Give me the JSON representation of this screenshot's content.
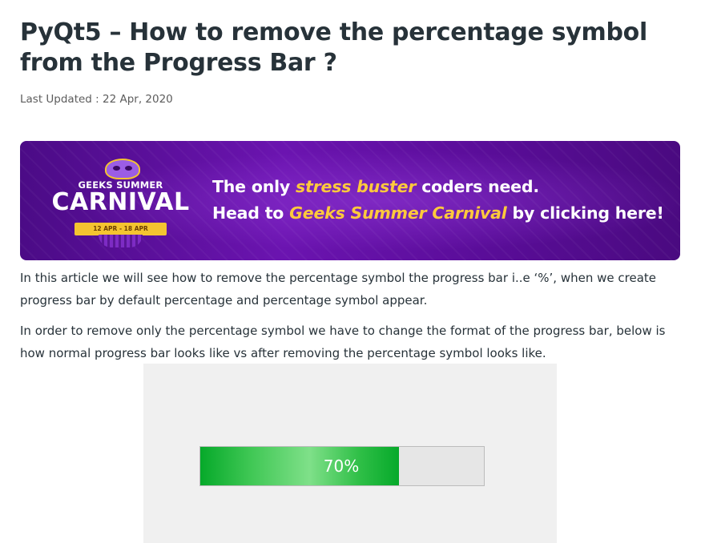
{
  "article": {
    "title": "PyQt5 – How to remove the percentage symbol from the Progress Bar ?",
    "last_updated": "Last Updated : 22 Apr, 2020"
  },
  "banner": {
    "logo_top": "GEEKS SUMMER",
    "logo_main": "CARNIVAL",
    "logo_dates": "12 APR - 18 APR",
    "line1_a": "The only ",
    "line1_highlight": "stress buster",
    "line1_b": " coders need.",
    "line2_a": "Head to ",
    "line2_highlight": "Geeks Summer Carnival",
    "line2_b": " by clicking here!",
    "colors": {
      "background": "#5a0d99",
      "highlight": "#ffc93c",
      "text": "#ffffff"
    }
  },
  "paragraphs": [
    "In this article we will see how to remove the percentage symbol the progress bar i..e ‘%’, when we create progress bar by default percentage and percentage symbol appear.",
    "In order to remove only the percentage symbol we have to change the format of the progress bar, below is how normal progress bar looks like vs after removing the percentage symbol looks like."
  ],
  "figure": {
    "progress_value": 0.7,
    "progress_text": "70%",
    "colors": {
      "fill": "#06a92a",
      "track": "#e6e6e6",
      "background": "#f0f0f0"
    }
  }
}
